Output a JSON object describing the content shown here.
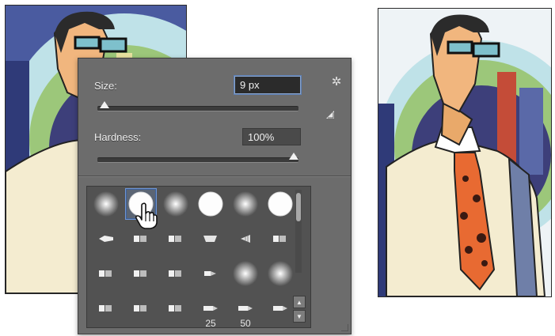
{
  "brush_panel": {
    "size_label": "Size:",
    "size_value": "9 px",
    "size_slider_fraction": 0.02,
    "hardness_label": "Hardness:",
    "hardness_value": "100%",
    "hardness_slider_fraction": 1.0,
    "icons": {
      "settings": "gear-icon",
      "corner": "brush-angle-icon",
      "cursor": "hand-pointer-icon",
      "step_up": "arrow-up-icon",
      "step_down": "arrow-down-icon"
    }
  },
  "brush_tips": [
    {
      "kind": "soft-round",
      "selected": false,
      "label": ""
    },
    {
      "kind": "hard-round",
      "selected": true,
      "label": ""
    },
    {
      "kind": "soft-round",
      "selected": false,
      "label": ""
    },
    {
      "kind": "hard-round",
      "selected": false,
      "label": ""
    },
    {
      "kind": "soft-round",
      "selected": false,
      "label": ""
    },
    {
      "kind": "hard-round",
      "selected": false,
      "label": ""
    },
    {
      "kind": "pen",
      "selected": false,
      "label": ""
    },
    {
      "kind": "chisel",
      "selected": false,
      "label": ""
    },
    {
      "kind": "chisel",
      "selected": false,
      "label": ""
    },
    {
      "kind": "flat",
      "selected": false,
      "label": ""
    },
    {
      "kind": "fan",
      "selected": false,
      "label": ""
    },
    {
      "kind": "chisel",
      "selected": false,
      "label": ""
    },
    {
      "kind": "chisel",
      "selected": false,
      "label": ""
    },
    {
      "kind": "chisel",
      "selected": false,
      "label": ""
    },
    {
      "kind": "chisel",
      "selected": false,
      "label": ""
    },
    {
      "kind": "stub",
      "selected": false,
      "label": ""
    },
    {
      "kind": "soft-round",
      "selected": false,
      "label": ""
    },
    {
      "kind": "soft-round",
      "selected": false,
      "label": ""
    },
    {
      "kind": "chisel",
      "selected": false,
      "label": ""
    },
    {
      "kind": "chisel",
      "selected": false,
      "label": ""
    },
    {
      "kind": "chisel",
      "selected": false,
      "label": ""
    },
    {
      "kind": "pencil",
      "selected": false,
      "label": "25"
    },
    {
      "kind": "pencil",
      "selected": false,
      "label": "50"
    },
    {
      "kind": "pencil",
      "selected": false,
      "label": ""
    }
  ]
}
